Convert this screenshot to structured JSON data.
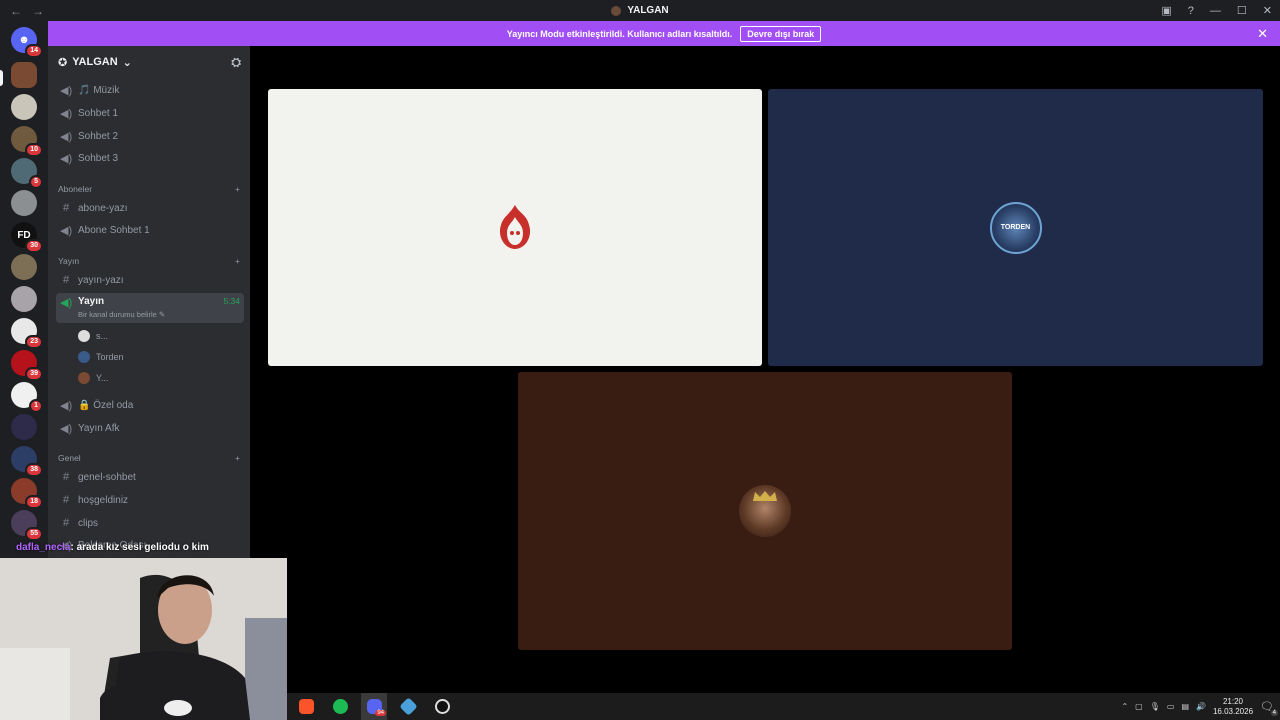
{
  "window": {
    "title": "YALGAN",
    "back": "←",
    "forward": "→",
    "minimize": "—",
    "maximize": "☐",
    "close": "✕"
  },
  "rail": {
    "home_badge": "14",
    "badges": [
      "10",
      "5",
      "30",
      "23",
      "39",
      "1",
      "38",
      "18",
      "55"
    ],
    "fd_label": "FD"
  },
  "banner": {
    "text": "Yayıncı Modu etkinleştirildi. Kullanıcı adları kısaltıldı.",
    "button": "Devre dışı bırak",
    "close": "✕"
  },
  "guild": {
    "name": "YALGAN",
    "chevron": "⌄"
  },
  "channels": {
    "voice_top": [
      {
        "label": "🎵 Müzik"
      },
      {
        "label": "Sohbet 1"
      },
      {
        "label": "Sohbet 2"
      },
      {
        "label": "Sohbet 3"
      }
    ],
    "cat_aboneler": "Aboneler",
    "aboneler": [
      {
        "label": "abone-yazı",
        "type": "text"
      },
      {
        "label": "Abone Sohbet 1",
        "type": "voice"
      }
    ],
    "cat_yayin": "Yayın",
    "yayin_text": "yayın-yazı",
    "active": {
      "label": "Yayın",
      "timer": "5:34",
      "status": "Bir kanal durumu belirle"
    },
    "users": [
      "s...",
      "Torden",
      "Y..."
    ],
    "after_voice": [
      {
        "label": "🔒 Özel oda"
      },
      {
        "label": "Yayın Afk"
      }
    ],
    "cat_genel": "Genel",
    "genel": [
      "genel-sohbet",
      "hoşgeldiniz",
      "clips",
      "Bekleme Odası"
    ],
    "plus": "+"
  },
  "stage": {
    "tiles": [
      {
        "name": "tile-1",
        "bg": "#f2f2ee",
        "avatar": "flame-skull"
      },
      {
        "name": "tile-2",
        "bg": "#1f2b48",
        "avatar": "torden-logo",
        "avatar_text": "TORDEN"
      },
      {
        "name": "tile-3",
        "bg": "#3a1d12",
        "avatar": "crowned-man"
      }
    ]
  },
  "chat": {
    "username": "dafla_necla",
    "message": ": arada kız sesi geliodu o kim"
  },
  "taskbar": {
    "apps": [
      "brave-icon",
      "spotify-icon",
      "discord-icon",
      "app-icon",
      "obs-icon"
    ],
    "discord_badge": "94",
    "time": "21:20",
    "date": "16.03.2026",
    "notif": "4"
  },
  "colors": {
    "banner": "#a14ff5",
    "sidebar": "#2b2d31",
    "rail": "#1e1f22",
    "speaking": "#23a55a"
  }
}
